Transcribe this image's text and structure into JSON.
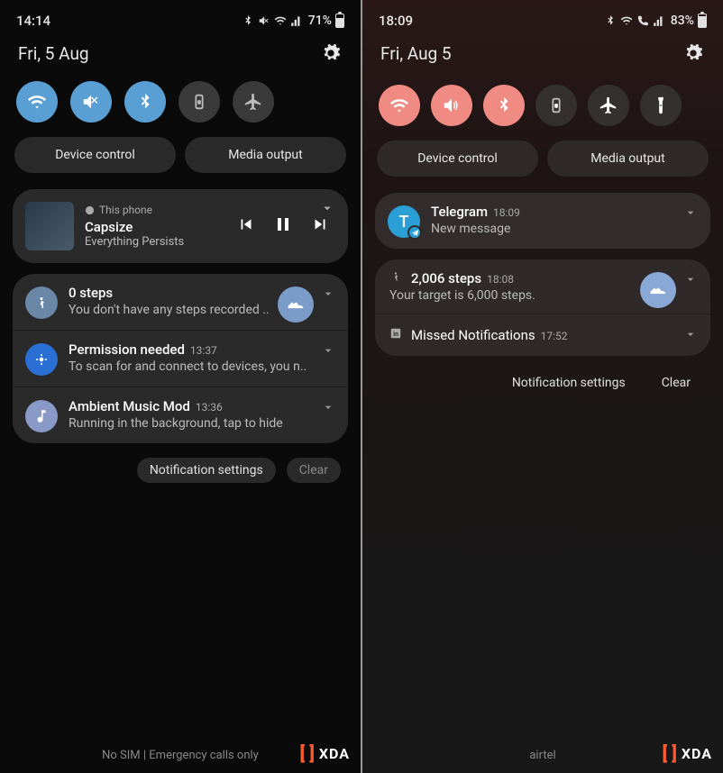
{
  "left": {
    "status": {
      "time": "14:14",
      "battery_pct": "71%",
      "battery_fill": 71
    },
    "date": "Fri, 5 Aug",
    "pills": {
      "device_control": "Device control",
      "media_output": "Media output"
    },
    "media": {
      "source": "This phone",
      "title": "Capsize",
      "artist": "Everything Persists"
    },
    "notifications": [
      {
        "title": "0 steps",
        "msg": "You don't have any steps recorded ..",
        "time": "",
        "icon": "steps",
        "action_icon": "shoe"
      },
      {
        "title": "Permission needed",
        "msg": "To scan for and connect to devices, you n..",
        "time": "13:37",
        "icon": "bluetooth-app"
      },
      {
        "title": "Ambient Music Mod",
        "msg": "Running in the background, tap to hide",
        "time": "13:36",
        "icon": "music"
      }
    ],
    "footer": {
      "settings": "Notification settings",
      "clear": "Clear"
    },
    "carrier": "No SIM | Emergency calls only"
  },
  "right": {
    "status": {
      "time": "18:09",
      "battery_pct": "83%",
      "battery_fill": 83
    },
    "date": "Fri, Aug 5",
    "pills": {
      "device_control": "Device control",
      "media_output": "Media output"
    },
    "notifications": {
      "telegram": {
        "title": "Telegram",
        "time": "18:09",
        "msg": "New message",
        "letter": "T"
      },
      "steps": {
        "title": "2,006 steps",
        "time": "18:08",
        "msg": "Your target is 6,000 steps."
      },
      "linkedin": {
        "title": "Missed Notifications",
        "time": "17:52"
      }
    },
    "footer": {
      "settings": "Notification settings",
      "clear": "Clear"
    },
    "carrier": "airtel"
  },
  "brand": "XDA"
}
